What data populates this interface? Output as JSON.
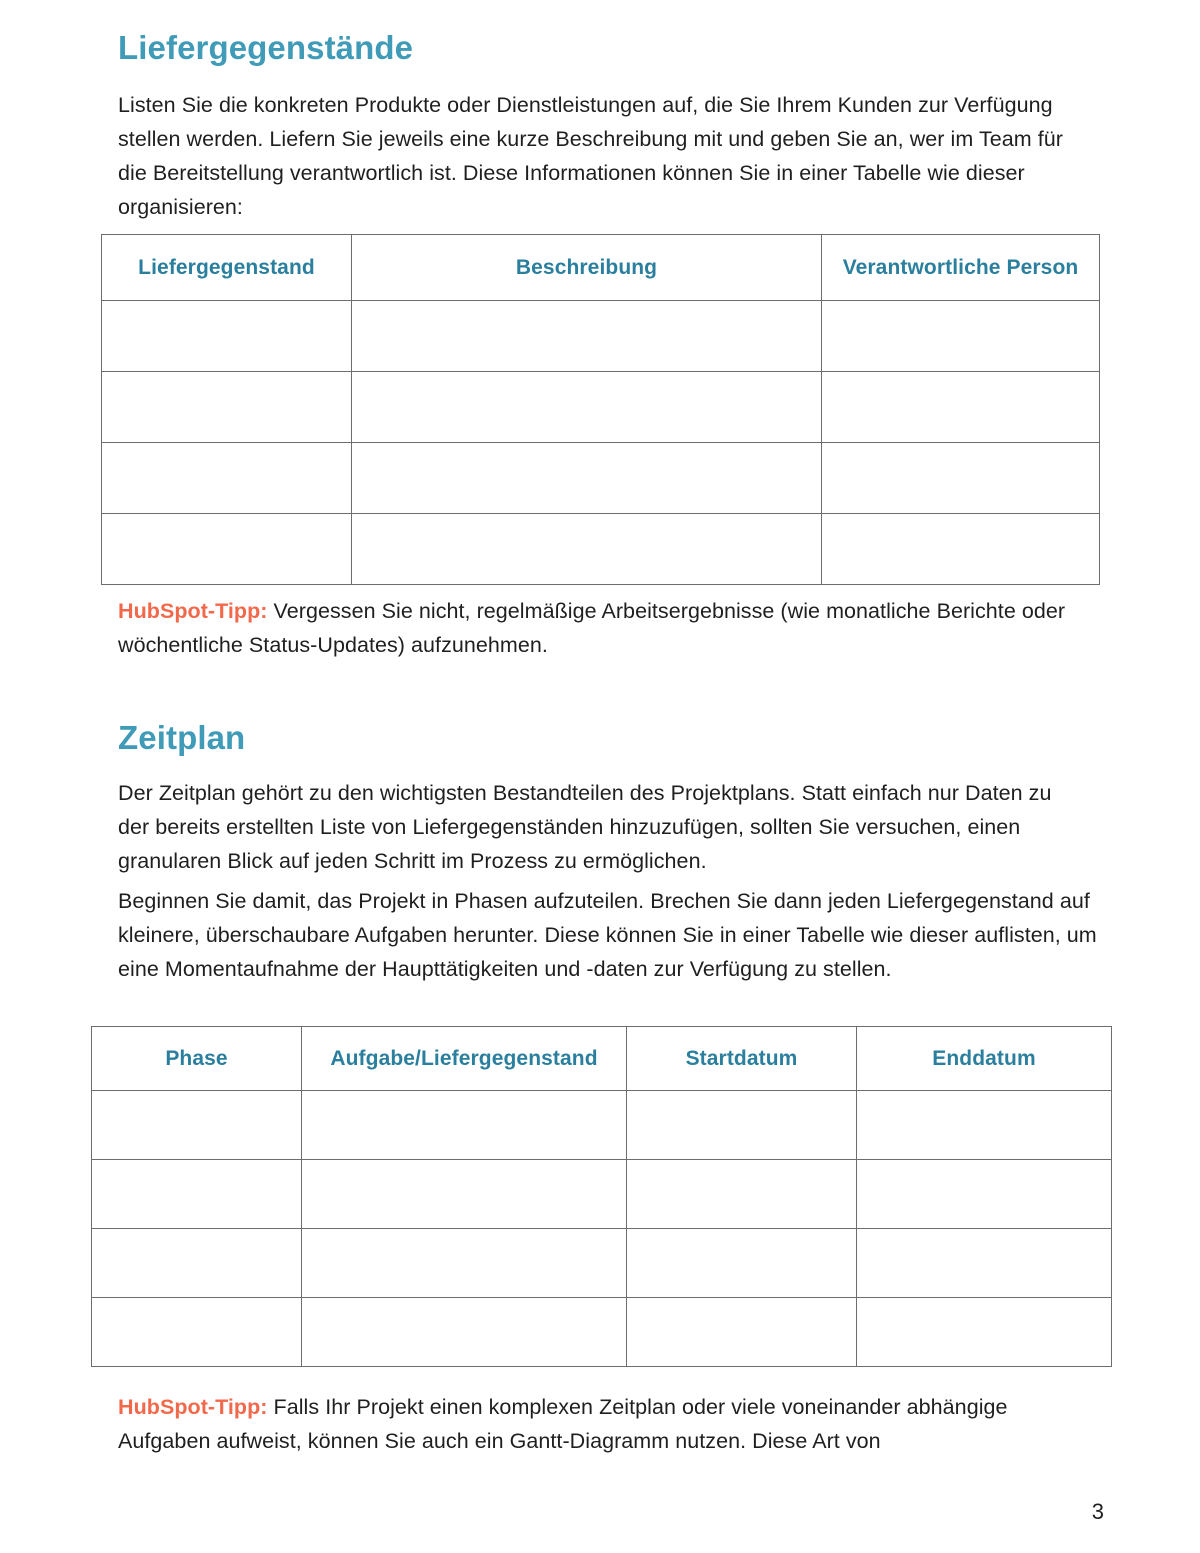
{
  "document": {
    "page_number": "3",
    "language": "de"
  },
  "colors": {
    "heading_teal": "#3f9bb7",
    "table_header_teal": "#2b7f9e",
    "tip_orange": "#f2684a",
    "body_text": "#1f1f1f",
    "table_border": "#6d6d6d"
  },
  "sections": [
    {
      "id": "liefergegenstaende",
      "title": "Liefergegenstände",
      "paragraphs": [
        "Listen Sie die konkreten Produkte oder Dienstleistungen auf, die Sie Ihrem Kunden zur Verfügung stellen werden. Liefern Sie jeweils eine kurze Beschreibung mit und geben Sie an, wer im Team für die Bereitstellung verantwortlich ist. Diese Informationen können Sie in einer Tabelle wie dieser organisieren:"
      ],
      "table": {
        "headers": [
          "Liefergegenstand",
          "Beschreibung",
          "Verantwortliche Person"
        ],
        "rows": [
          [
            "",
            "",
            ""
          ],
          [
            "",
            "",
            ""
          ],
          [
            "",
            "",
            ""
          ],
          [
            "",
            "",
            ""
          ]
        ]
      },
      "tip": {
        "label": "HubSpot-Tipp:",
        "text": " Vergessen Sie nicht, regelmäßige Arbeitsergebnisse (wie monatliche Berichte oder wöchentliche Status-Updates) aufzunehmen."
      }
    },
    {
      "id": "zeitplan",
      "title": "Zeitplan",
      "paragraphs": [
        "Der Zeitplan gehört zu den wichtigsten Bestandteilen des Projektplans. Statt einfach nur Daten zu der bereits erstellten Liste von Liefergegenständen hinzuzufügen, sollten Sie versuchen, einen granularen Blick auf jeden Schritt im Prozess zu ermöglichen.",
        "Beginnen Sie damit, das Projekt in Phasen aufzuteilen. Brechen Sie dann jeden Liefergegenstand auf kleinere, überschaubare Aufgaben herunter. Diese können Sie in einer Tabelle wie dieser auflisten, um eine Momentaufnahme der Haupttätigkeiten und -daten zur Verfügung zu stellen."
      ],
      "table": {
        "headers": [
          "Phase",
          "Aufgabe/Liefergegenstand",
          "Startdatum",
          "Enddatum"
        ],
        "rows": [
          [
            "",
            "",
            "",
            ""
          ],
          [
            "",
            "",
            "",
            ""
          ],
          [
            "",
            "",
            "",
            ""
          ],
          [
            "",
            "",
            "",
            ""
          ]
        ]
      },
      "tip": {
        "label": "HubSpot-Tipp:",
        "text": " Falls Ihr Projekt einen komplexen Zeitplan oder viele voneinander abhängige Aufgaben aufweist, können Sie auch ein Gantt-Diagramm nutzen. Diese Art von"
      }
    }
  ]
}
